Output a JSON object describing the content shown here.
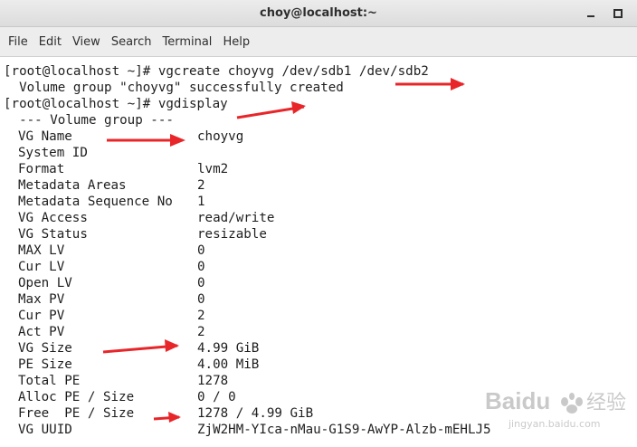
{
  "window": {
    "title": "choy@localhost:~",
    "minimize_icon": "minimize-icon",
    "maximize_icon": "maximize-icon"
  },
  "menu": [
    "File",
    "Edit",
    "View",
    "Search",
    "Terminal",
    "Help"
  ],
  "terminal": {
    "cmd1": "[root@localhost ~]# vgcreate choyvg /dev/sdb1 /dev/sdb2",
    "out1": "  Volume group \"choyvg\" successfully created",
    "cmd2": "[root@localhost ~]# vgdisplay",
    "header": "  --- Volume group ---",
    "rows": [
      {
        "k": "VG Name",
        "v": "choyvg"
      },
      {
        "k": "System ID",
        "v": ""
      },
      {
        "k": "Format",
        "v": "lvm2"
      },
      {
        "k": "Metadata Areas",
        "v": "2"
      },
      {
        "k": "Metadata Sequence No",
        "v": "1"
      },
      {
        "k": "VG Access",
        "v": "read/write"
      },
      {
        "k": "VG Status",
        "v": "resizable"
      },
      {
        "k": "MAX LV",
        "v": "0"
      },
      {
        "k": "Cur LV",
        "v": "0"
      },
      {
        "k": "Open LV",
        "v": "0"
      },
      {
        "k": "Max PV",
        "v": "0"
      },
      {
        "k": "Cur PV",
        "v": "2"
      },
      {
        "k": "Act PV",
        "v": "2"
      },
      {
        "k": "VG Size",
        "v": "4.99 GiB"
      },
      {
        "k": "PE Size",
        "v": "4.00 MiB"
      },
      {
        "k": "Total PE",
        "v": "1278"
      },
      {
        "k": "Alloc PE / Size",
        "v": "0 / 0"
      },
      {
        "k": "Free  PE / Size",
        "v": "1278 / 4.99 GiB"
      },
      {
        "k": "VG UUID",
        "v": "ZjW2HM-YIca-nMau-G1S9-AwYP-Alzb-mEHLJ5"
      }
    ]
  },
  "annotations": {
    "arrow_color": "#e8262a",
    "arrow_icon": "red-arrow-icon"
  },
  "watermark": {
    "brand": "Baidu",
    "cn_text": "经验",
    "url": "jingyan.baidu.com"
  }
}
